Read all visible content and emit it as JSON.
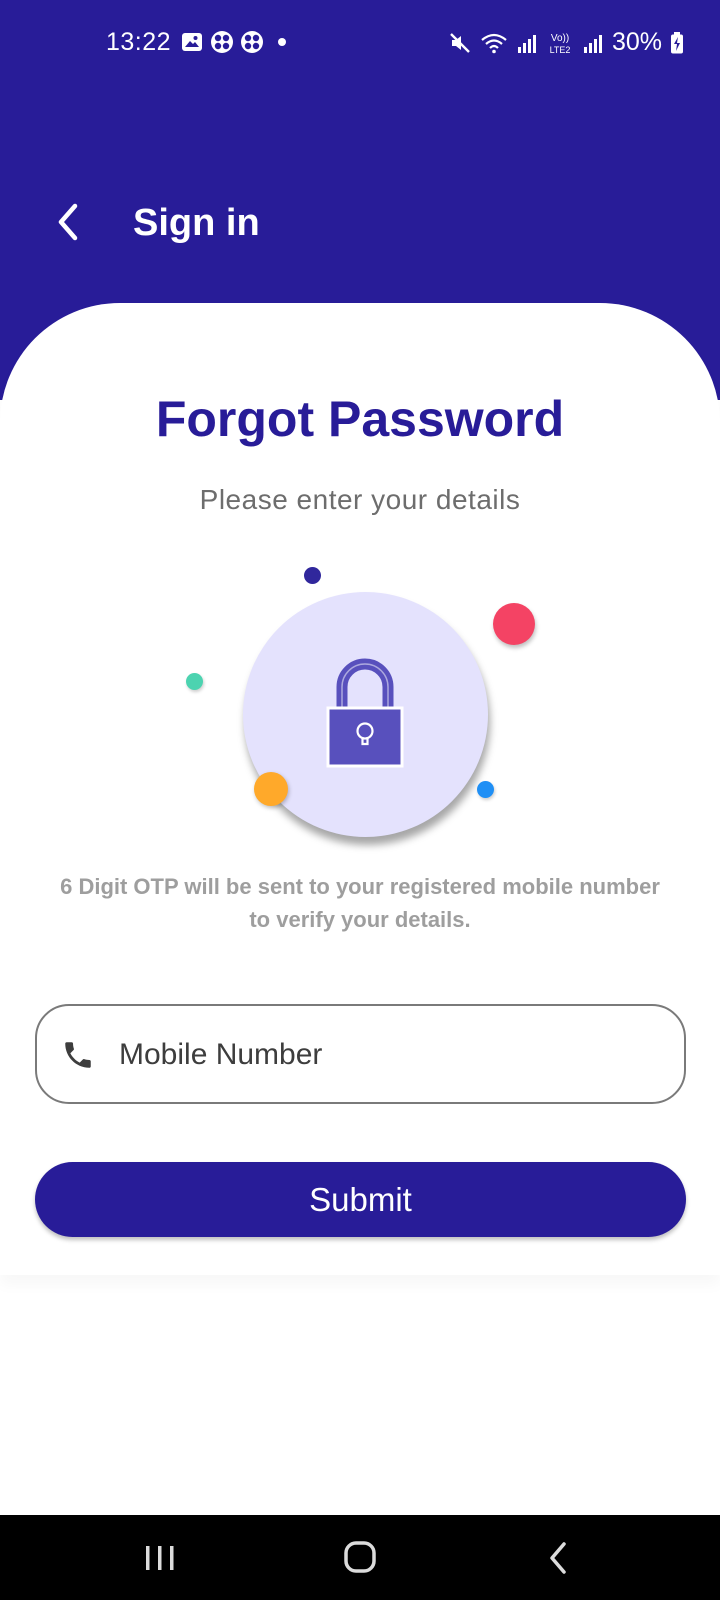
{
  "status_bar": {
    "time": "13:22",
    "battery": "30%",
    "left_icons": [
      "gallery-icon",
      "pinwheel-icon",
      "pinwheel-icon",
      "notification-dot-icon"
    ],
    "right_icons": [
      "mute-icon",
      "wifi-icon",
      "signal-icon",
      "volte-lte2-icon",
      "signal-icon",
      "battery-charging-icon"
    ]
  },
  "header": {
    "back_icon": "chevron-left-icon",
    "title": "Sign in",
    "background_color": "#281c98"
  },
  "main": {
    "title": "Forgot Password",
    "subtitle": "Please enter your details",
    "illustration_icon": "padlock-icon",
    "info": "6 Digit OTP will be sent to your registered mobile number to verify your details.",
    "mobile_field": {
      "icon": "phone-icon",
      "placeholder": "Mobile Number",
      "value": ""
    },
    "submit_label": "Submit"
  },
  "colors": {
    "primary": "#281c98",
    "lock_bg": "#e4e2fd",
    "lock_body": "#5850bd",
    "accent_red": "#f44364",
    "accent_orange": "#ffa92a",
    "accent_teal": "#4cd3b0",
    "accent_blue": "#1f8ff5"
  },
  "nav_bar": {
    "icons": [
      "recents-icon",
      "home-icon",
      "back-icon"
    ]
  }
}
